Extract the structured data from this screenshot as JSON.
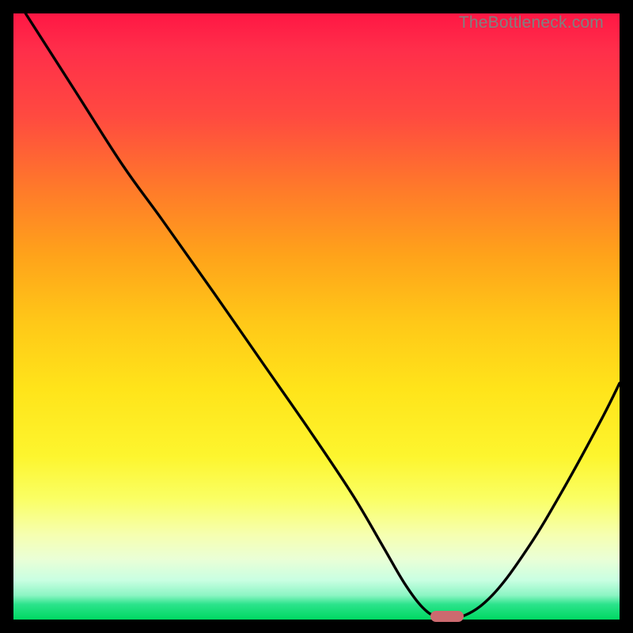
{
  "watermark": "TheBottleneck.com",
  "colors": {
    "background": "#000000",
    "curve": "#000000",
    "marker": "#cc6a6f"
  },
  "chart_data": {
    "type": "line",
    "title": "",
    "xlabel": "",
    "ylabel": "",
    "xlim": [
      0,
      100
    ],
    "ylim": [
      0,
      100
    ],
    "grid": false,
    "legend": false,
    "series": [
      {
        "name": "bottleneck-curve",
        "x": [
          2.0,
          10.0,
          18.0,
          24.5,
          33.0,
          41.0,
          49.0,
          56.0,
          61.0,
          64.5,
          67.5,
          70.0,
          74.0,
          79.0,
          85.0,
          91.0,
          97.0,
          100.0
        ],
        "values": [
          100.0,
          87.5,
          75.0,
          66.0,
          54.0,
          42.5,
          31.0,
          20.5,
          12.0,
          6.0,
          2.0,
          0.5,
          0.5,
          4.0,
          12.0,
          22.0,
          33.0,
          39.0
        ]
      }
    ],
    "marker": {
      "x": 71.5,
      "y": 0.5,
      "width_pct": 5.5
    }
  }
}
